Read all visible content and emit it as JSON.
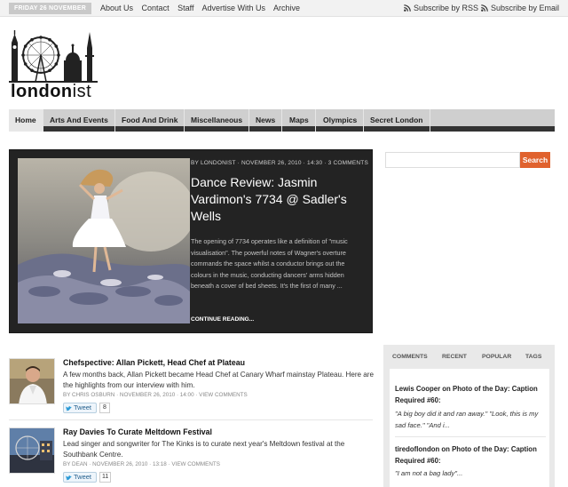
{
  "topbar": {
    "date": "FRIDAY 26 NOVEMBER 2010",
    "links": [
      "About Us",
      "Contact",
      "Staff",
      "Advertise With Us",
      "Archive"
    ],
    "subscribe_rss": "Subscribe by RSS",
    "subscribe_email": "Subscribe by Email"
  },
  "logo": {
    "text_bold": "london",
    "text_light": "ist"
  },
  "nav": {
    "items": [
      "Home",
      "Arts And Events",
      "Food And Drink",
      "Miscellaneous",
      "News",
      "Maps",
      "Olympics",
      "Secret London"
    ]
  },
  "search": {
    "value": "",
    "button": "Search"
  },
  "featured": {
    "meta": "BY LONDONIST · NOVEMBER 26, 2010 · 14:30 · 3 COMMENTS",
    "title": "Dance Review: Jasmin Vardimon's 7734 @ Sadler's Wells",
    "excerpt": "The opening of 7734 operates like a definition of \"music visualisation\". The powerful notes of Wagner's overture commands the space whilst a conductor brings out the colours in the music, conducting dancers' arms hidden beneath a cover of bed sheets. It's the first of many ...",
    "more": "CONTINUE READING..."
  },
  "articles": [
    {
      "title": "Chefspective: Allan Pickett, Head Chef at Plateau",
      "excerpt": "A few months back, Allan Pickett became Head Chef at Canary Wharf mainstay Plateau. Here are the highlights from our interview with him.",
      "meta": "BY CHRIS OSBURN · NOVEMBER 26, 2010 · 14:00 · VIEW COMMENTS",
      "tweet": "Tweet",
      "count": "8"
    },
    {
      "title": "Ray Davies To Curate Meltdown Festival",
      "excerpt": "Lead singer and songwriter for The Kinks is to curate next year's Meltdown festival at the Southbank Centre.",
      "meta": "BY DEAN · NOVEMBER 26, 2010 · 13:18 · VIEW COMMENTS",
      "tweet": "Tweet",
      "count": "11"
    }
  ],
  "sidebar": {
    "tabs": [
      "COMMENTS",
      "RECENT",
      "POPULAR",
      "TAGS"
    ],
    "comments": [
      {
        "author": "Lewis Cooper",
        "on": "on",
        "post": "Photo of the Day: Caption Required #60:",
        "quote": "\"A big boy did it and ran away.\" \"Look, this is my sad face.\" \"And i..."
      },
      {
        "author": "tiredoflondon",
        "on": "on",
        "post": "Photo of the Day: Caption Required #60:",
        "quote": "\"I am not a bag lady\"..."
      }
    ]
  },
  "colors": {
    "accent": "#e0622e",
    "nav_bg": "#cfcfcf",
    "featured_bg": "#232323"
  }
}
